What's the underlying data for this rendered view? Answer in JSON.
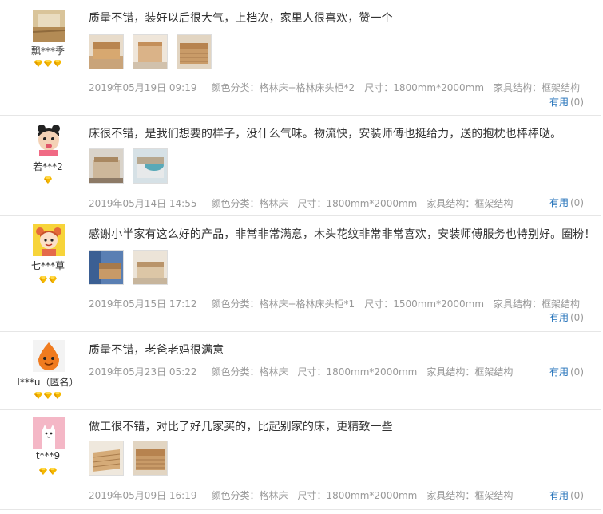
{
  "reviews": [
    {
      "user": "飘***季",
      "gems": 3,
      "text": "质量不错，装好以后很大气，上档次，家里人很喜欢，赞一个",
      "date": "2019年05月19日 09:19",
      "color": "颜色分类：格林床+格林床头柜*2",
      "size": "尺寸：1800mm*2000mm",
      "structure": "家具结构：框架结构",
      "useful_label": "有用",
      "useful_count": "(0)"
    },
    {
      "user": "若***2",
      "gems": 1,
      "text": "床很不错，是我们想要的样子，没什么气味。物流快，安装师傅也挺给力，送的抱枕也棒棒哒。",
      "date": "2019年05月14日 14:55",
      "color": "颜色分类：格林床",
      "size": "尺寸：1800mm*2000mm",
      "structure": "家具结构：框架结构",
      "useful_label": "有用",
      "useful_count": "(0)"
    },
    {
      "user": "七***草",
      "gems": 2,
      "text": "感谢小半家有这么好的产品，非常非常满意，木头花纹非常非常喜欢，安装师傅服务也特别好。圈粉！",
      "date": "2019年05月15日 17:12",
      "color": "颜色分类：格林床+格林床头柜*1",
      "size": "尺寸：1500mm*2000mm",
      "structure": "家具结构：框架结构",
      "useful_label": "有用",
      "useful_count": "(0)"
    },
    {
      "user": "l***u（匿名）",
      "gems": 3,
      "text": "质量不错，老爸老妈很满意",
      "date": "2019年05月23日 05:22",
      "color": "颜色分类：格林床",
      "size": "尺寸：1800mm*2000mm",
      "structure": "家具结构：框架结构",
      "useful_label": "有用",
      "useful_count": "(0)"
    },
    {
      "user": "t***9",
      "gems": 2,
      "text": "做工很不错，对比了好几家买的，比起别家的床，更精致一些",
      "date": "2019年05月09日 16:19",
      "color": "颜色分类：格林床",
      "size": "尺寸：1800mm*2000mm",
      "structure": "家具结构：框架结构",
      "useful_label": "有用",
      "useful_count": "(0)"
    }
  ],
  "colors": {
    "useful_link": "#1f6fb8",
    "meta_text": "#999999",
    "gem": "#f5b800"
  }
}
